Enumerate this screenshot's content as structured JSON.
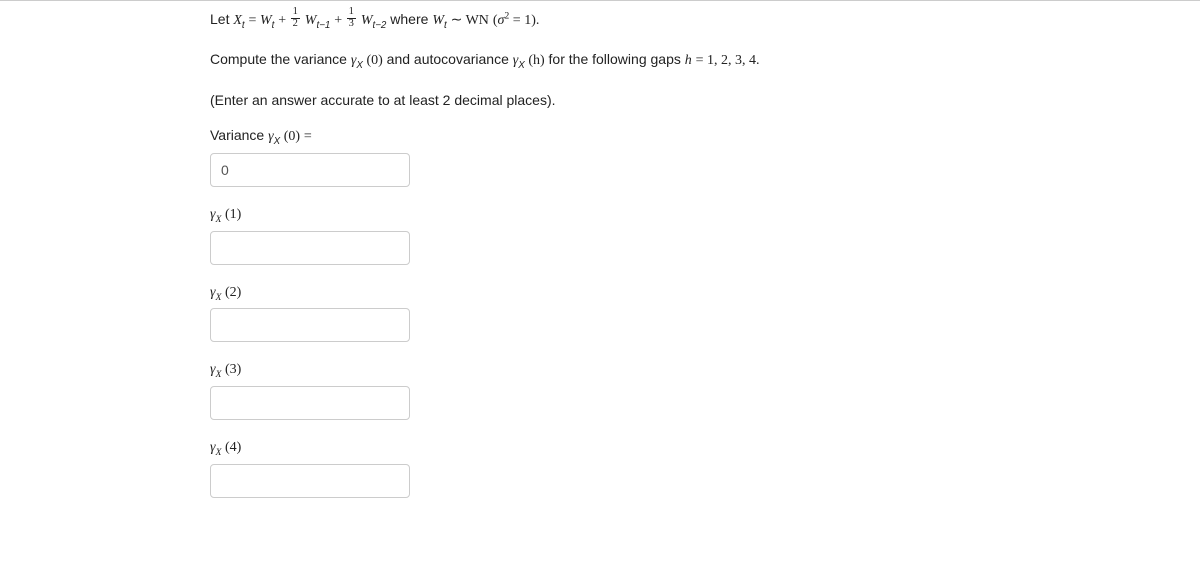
{
  "problem": {
    "line1_prefix": "Let ",
    "eq_lhs_X": "X",
    "eq_lhs_t": "t",
    "eq_eq": " = ",
    "W": "W",
    "t": "t",
    "plus": " + ",
    "t_m1": "t−1",
    "t_m2": "t−2",
    "where": " where ",
    "sim": " ∼ ",
    "WN": "WN",
    "sigma2eq1_open": " (",
    "sigma": "σ",
    "two": "2",
    "eq1": " = 1).",
    "line2_a": "Compute the variance ",
    "gamma": "γ",
    "Xsub": "X",
    "zero_paren": " (0)",
    "line2_b": " and autocovariance ",
    "h_paren": " (h)",
    "line2_c": " for the following gaps ",
    "h": "h",
    "eq_list": " = 1, 2, 3, 4.",
    "line3": "(Enter an answer accurate to at least 2 decimal places)."
  },
  "variance": {
    "label_prefix": "Variance ",
    "label_suffix": " =",
    "value": "0"
  },
  "items": [
    {
      "arg": "(1)",
      "value": ""
    },
    {
      "arg": "(2)",
      "value": ""
    },
    {
      "arg": "(3)",
      "value": ""
    },
    {
      "arg": "(4)",
      "value": ""
    }
  ]
}
